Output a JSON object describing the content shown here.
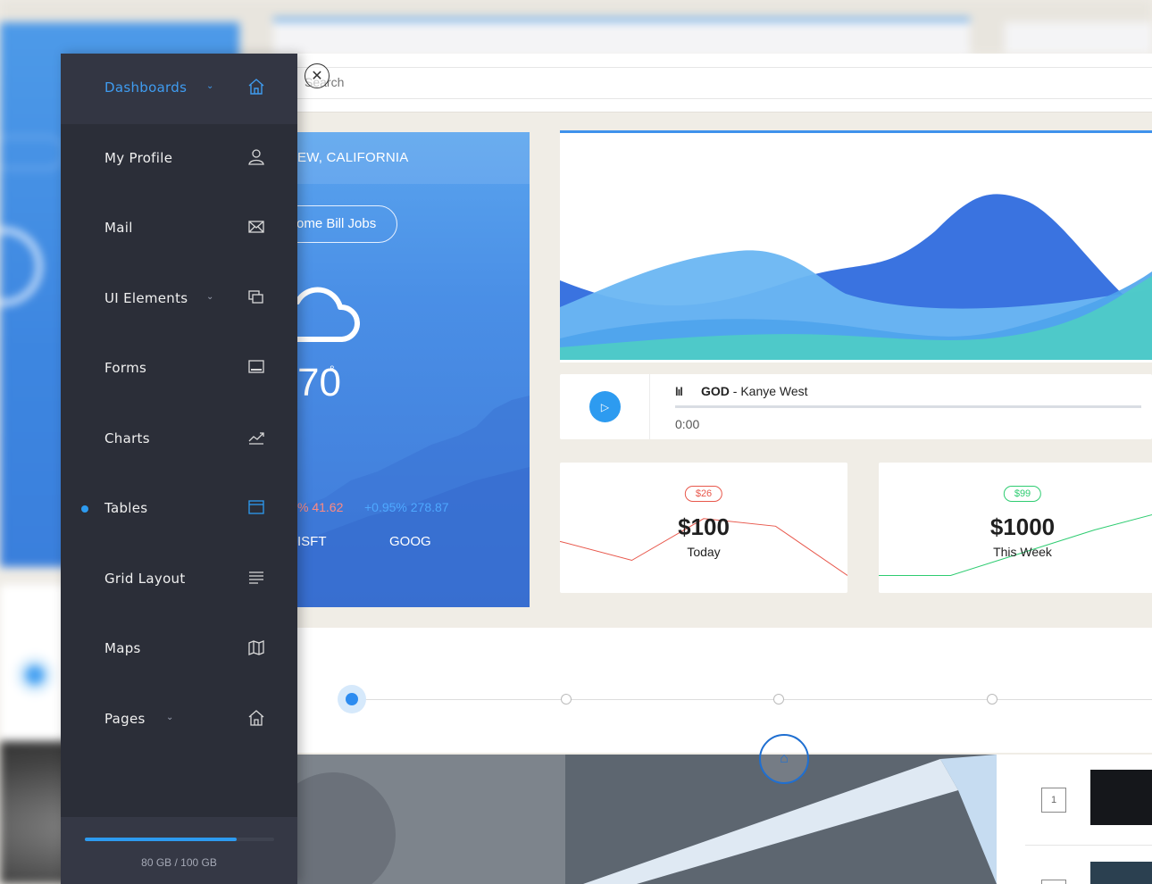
{
  "search": {
    "placeholder": "Search"
  },
  "sidebar": {
    "items": [
      {
        "label": "Dashboards",
        "icon": "home-icon",
        "has_chevron": true,
        "active": true
      },
      {
        "label": "My Profile",
        "icon": "user-icon"
      },
      {
        "label": "Mail",
        "icon": "mail-icon"
      },
      {
        "label": "UI Elements",
        "icon": "copy-icon",
        "has_chevron": true
      },
      {
        "label": "Forms",
        "icon": "form-icon"
      },
      {
        "label": "Charts",
        "icon": "trend-icon"
      },
      {
        "label": "Tables",
        "icon": "table-icon",
        "current": true
      },
      {
        "label": "Grid Layout",
        "icon": "lines-icon"
      },
      {
        "label": "Maps",
        "icon": "map-icon"
      },
      {
        "label": "Pages",
        "icon": "home-outline-icon",
        "has_chevron": true
      }
    ],
    "storage": {
      "text": "80 GB / 100 GB",
      "fraction": 0.8
    }
  },
  "weather": {
    "location": "EW, CALIFORNIA",
    "pill": "ome Bill Jobs",
    "temperature": "70",
    "degree": "°",
    "stocks": [
      {
        "change": "% 41.62",
        "symbol": "ISFT"
      },
      {
        "change": "+0.95% 278.87",
        "symbol": "GOOG"
      }
    ]
  },
  "player": {
    "title": "GOD",
    "separator": " - ",
    "artist": "Kanye West",
    "time": "0:00"
  },
  "stats": [
    {
      "badge": "$26",
      "amount": "$100",
      "label": "Today",
      "color": "#e8574b",
      "trend": [
        0.55,
        0.3,
        0.85,
        0.75,
        0.1
      ]
    },
    {
      "badge": "$99",
      "amount": "$1000",
      "label": "This Week",
      "color": "#2ecc71",
      "trend": [
        0.1,
        0.1,
        0.4,
        0.7,
        0.95
      ]
    }
  ],
  "list": {
    "items": [
      {
        "number": "1"
      }
    ]
  },
  "colors": {
    "accent": "#2d9bf0",
    "sidebar": "#2b2e38",
    "wave_dark": "#3a73e0",
    "wave_light": "#6ab6f2",
    "wave_teal": "#4ecdc4"
  }
}
